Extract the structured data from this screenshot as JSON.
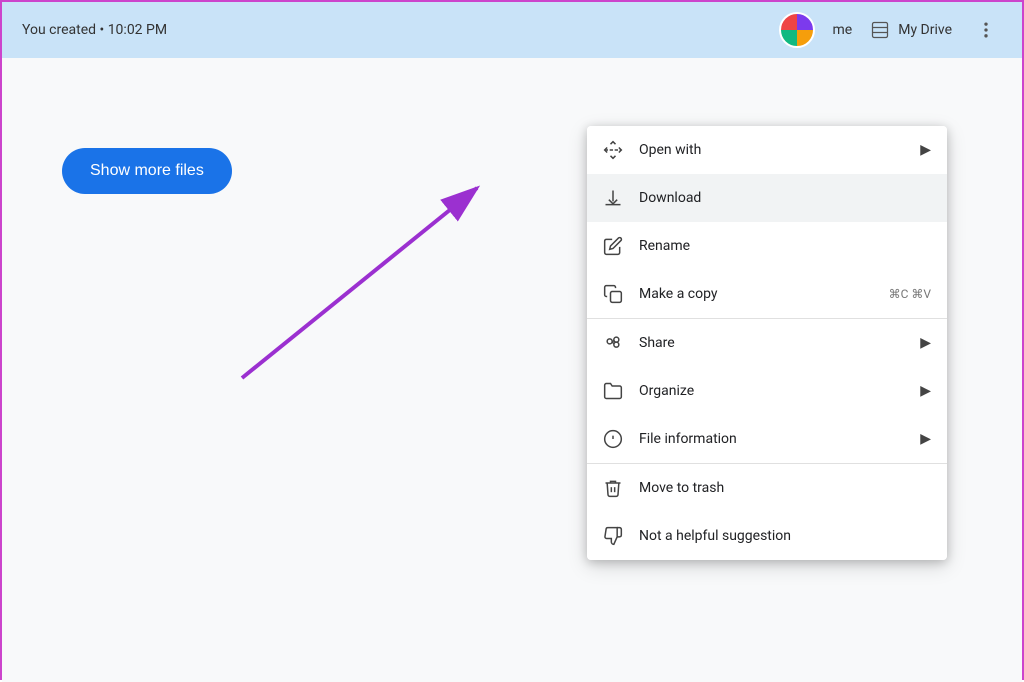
{
  "topbar": {
    "created_text": "You created • 10:02 PM",
    "user_name": "me",
    "my_drive_label": "My Drive"
  },
  "main": {
    "show_more_button": "Show more files"
  },
  "context_menu": {
    "sections": [
      {
        "items": [
          {
            "id": "open-with",
            "label": "Open with",
            "has_arrow": true,
            "shortcut": ""
          },
          {
            "id": "download",
            "label": "Download",
            "has_arrow": false,
            "shortcut": "",
            "highlighted": true
          },
          {
            "id": "rename",
            "label": "Rename",
            "has_arrow": false,
            "shortcut": ""
          },
          {
            "id": "make-a-copy",
            "label": "Make a copy",
            "has_arrow": false,
            "shortcut": "⌘C ⌘V"
          }
        ]
      },
      {
        "items": [
          {
            "id": "share",
            "label": "Share",
            "has_arrow": true,
            "shortcut": ""
          },
          {
            "id": "organize",
            "label": "Organize",
            "has_arrow": true,
            "shortcut": ""
          },
          {
            "id": "file-information",
            "label": "File information",
            "has_arrow": true,
            "shortcut": ""
          }
        ]
      },
      {
        "items": [
          {
            "id": "move-to-trash",
            "label": "Move to trash",
            "has_arrow": false,
            "shortcut": ""
          },
          {
            "id": "not-helpful",
            "label": "Not a helpful suggestion",
            "has_arrow": false,
            "shortcut": ""
          }
        ]
      }
    ]
  }
}
